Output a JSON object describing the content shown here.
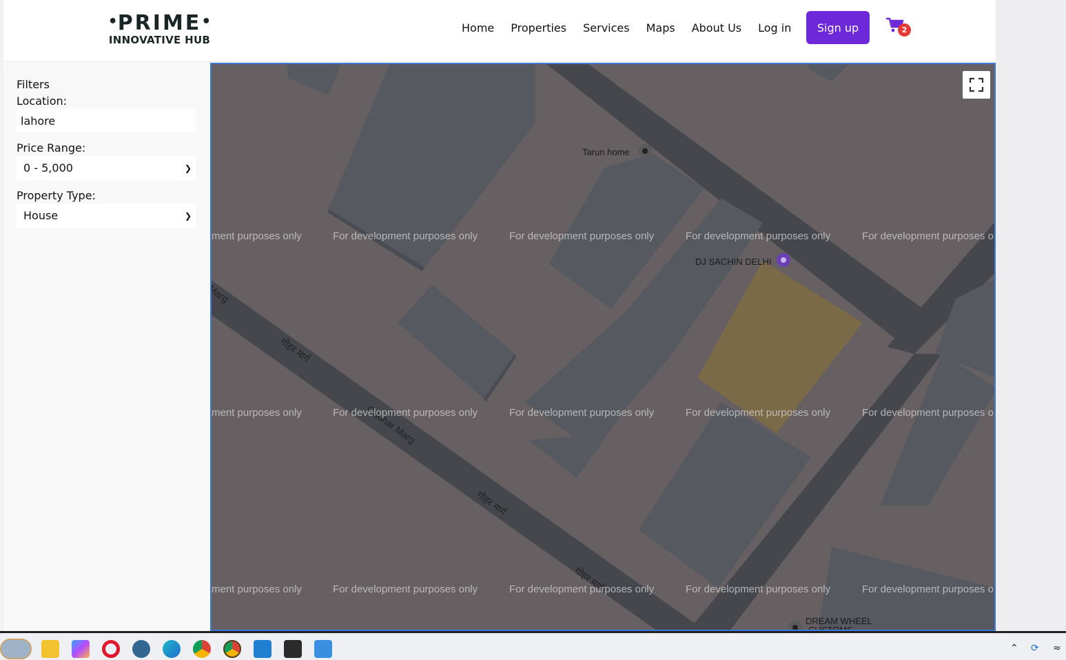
{
  "brand": {
    "line1": "PRIME",
    "line2": "INNOVATIVE HUB",
    "dot": "•"
  },
  "nav": [
    "Home",
    "Properties",
    "Services",
    "Maps",
    "About Us",
    "Log in"
  ],
  "signup_label": "Sign up",
  "cart": {
    "icon": "cart-icon",
    "count": "2"
  },
  "filters": {
    "title": "Filters",
    "location_label": "Location:",
    "location_value": "lahore",
    "price_label": "Price Range:",
    "price_value": "0 - 5,000",
    "type_label": "Property Type:",
    "type_value": "House"
  },
  "map": {
    "watermark": "For development purposes only",
    "watermark_partial_left": "ment purposes only",
    "watermark_partial_right": "For development purposes o",
    "pois": [
      "Tarun home",
      "DJ SACHIN DELHI",
      "DREAM WHEEL",
      "CUSTOMS"
    ],
    "roads": [
      "Marg",
      "Gauhar Marg",
      "गोहर मार्ग"
    ],
    "fullscreen_icon": "fullscreen-icon"
  },
  "taskbar": {
    "apps": [
      "map-thumbnail-icon",
      "file-explorer-icon",
      "copilot-icon",
      "opera-icon",
      "postgres-icon",
      "edge-icon",
      "chrome-icon",
      "chrome-dev-icon",
      "vscode-icon",
      "terminal-icon",
      "notepad-icon"
    ],
    "tray": [
      "chevron-up-icon",
      "sync-icon",
      "wifi-icon"
    ]
  },
  "colors": {
    "accent": "#6d28d9",
    "badge": "#e53935",
    "map_bg": "#666062",
    "road": "#45474d",
    "building": "#575961",
    "highlight": "#7a6a47"
  }
}
